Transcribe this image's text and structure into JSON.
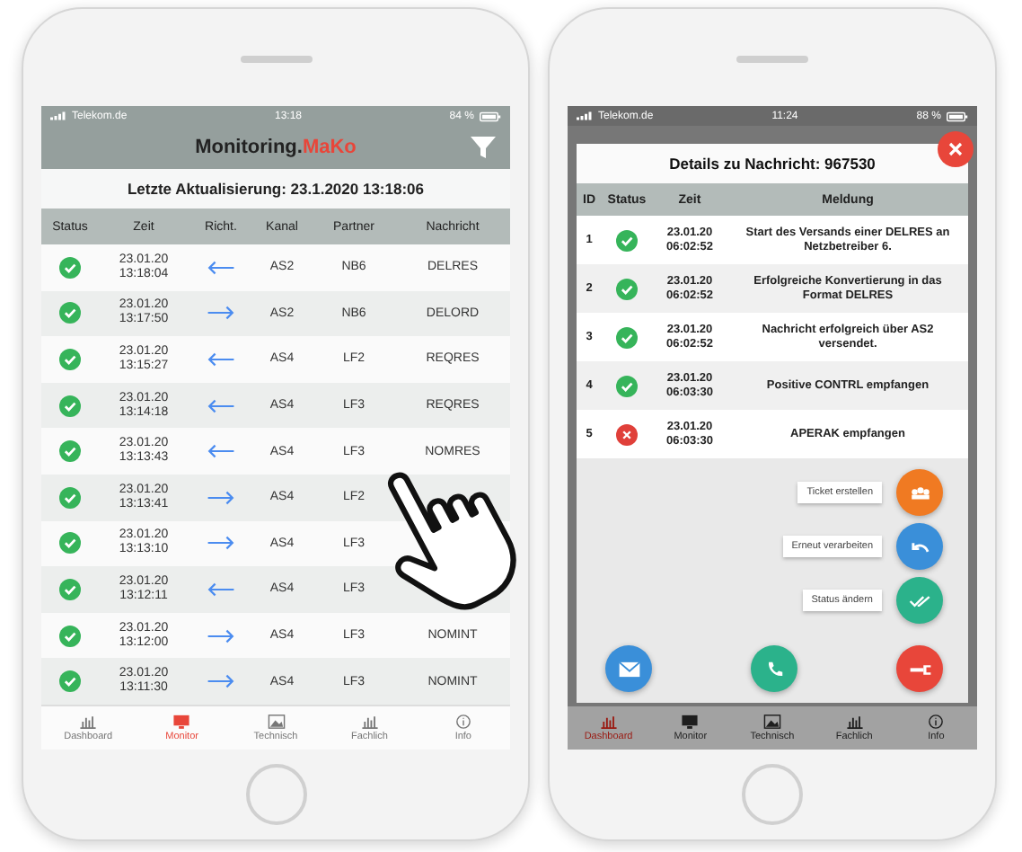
{
  "left_phone": {
    "status_bar": {
      "carrier": "Telekom.de",
      "time": "13:18",
      "battery": "84 %"
    },
    "app_bar": {
      "title": "Monitoring.",
      "title_accent": "MaKo"
    },
    "last_update": "Letzte Aktualisierung: 23.1.2020 13:18:06",
    "columns": [
      "Status",
      "Zeit",
      "Richt.",
      "Kanal",
      "Partner",
      "Nachricht"
    ],
    "rows": [
      {
        "ok": true,
        "date": "23.01.20",
        "time": "13:18:04",
        "incoming": true,
        "channel": "AS2",
        "partner": "NB6",
        "message": "DELRES"
      },
      {
        "ok": true,
        "date": "23.01.20",
        "time": "13:17:50",
        "incoming": false,
        "channel": "AS2",
        "partner": "NB6",
        "message": "DELORD"
      },
      {
        "ok": true,
        "date": "23.01.20",
        "time": "13:15:27",
        "incoming": true,
        "channel": "AS4",
        "partner": "LF2",
        "message": "REQRES"
      },
      {
        "ok": true,
        "date": "23.01.20",
        "time": "13:14:18",
        "incoming": true,
        "channel": "AS4",
        "partner": "LF3",
        "message": "REQRES"
      },
      {
        "ok": true,
        "date": "23.01.20",
        "time": "13:13:43",
        "incoming": true,
        "channel": "AS4",
        "partner": "LF3",
        "message": "NOMRES"
      },
      {
        "ok": true,
        "date": "23.01.20",
        "time": "13:13:41",
        "incoming": false,
        "channel": "AS4",
        "partner": "LF2"
      },
      {
        "ok": true,
        "date": "23.01.20",
        "time": "13:13:10",
        "incoming": false,
        "channel": "AS4",
        "partner": "LF3"
      },
      {
        "ok": true,
        "date": "23.01.20",
        "time": "13:12:11",
        "incoming": true,
        "channel": "AS4",
        "partner": "LF3"
      },
      {
        "ok": true,
        "date": "23.01.20",
        "time": "13:12:00",
        "incoming": false,
        "channel": "AS4",
        "partner": "LF3",
        "message": "NOMINT"
      },
      {
        "ok": true,
        "date": "23.01.20",
        "time": "13:11:30",
        "incoming": false,
        "channel": "AS4",
        "partner": "LF3",
        "message": "NOMINT"
      }
    ],
    "tabs": [
      {
        "label": "Dashboard",
        "selected": false
      },
      {
        "label": "Monitor",
        "selected": true
      },
      {
        "label": "Technisch",
        "selected": false
      },
      {
        "label": "Fachlich",
        "selected": false
      },
      {
        "label": "Info",
        "selected": false
      }
    ]
  },
  "right_phone": {
    "status_bar": {
      "carrier": "Telekom.de",
      "time": "11:24",
      "battery": "88 %"
    },
    "dialog": {
      "title": "Details zu Nachricht: 967530",
      "columns": [
        "ID",
        "Status",
        "Zeit",
        "Meldung"
      ],
      "entries": [
        {
          "id": "1",
          "ok": true,
          "date": "23.01.20",
          "time": "06:02:52",
          "message": "Start des Versands einer DELRES an Netzbetreiber 6."
        },
        {
          "id": "2",
          "ok": true,
          "date": "23.01.20",
          "time": "06:02:52",
          "message": "Erfolgreiche Konvertierung in das Format DELRES"
        },
        {
          "id": "3",
          "ok": true,
          "date": "23.01.20",
          "time": "06:02:52",
          "message": "Nachricht erfolgreich über AS2 versendet."
        },
        {
          "id": "4",
          "ok": true,
          "date": "23.01.20",
          "time": "06:03:30",
          "message": "Positive CONTRL empfangen"
        },
        {
          "id": "5",
          "ok": false,
          "date": "23.01.20",
          "time": "06:03:30",
          "message": "APERAK empfangen"
        }
      ],
      "actions": [
        {
          "label": "Ticket erstellen",
          "kind": "ticket"
        },
        {
          "label": "Erneut verarbeiten",
          "kind": "retry"
        },
        {
          "label": "Status ändern",
          "kind": "status"
        }
      ],
      "buttons": [
        {
          "kind": "mail"
        },
        {
          "kind": "phone"
        },
        {
          "kind": "tool"
        }
      ]
    },
    "tabs": [
      {
        "label": "Dashboard",
        "selected": true
      },
      {
        "label": "Monitor",
        "selected": false
      },
      {
        "label": "Technisch",
        "selected": false
      },
      {
        "label": "Fachlich",
        "selected": false
      },
      {
        "label": "Info",
        "selected": false
      }
    ]
  }
}
